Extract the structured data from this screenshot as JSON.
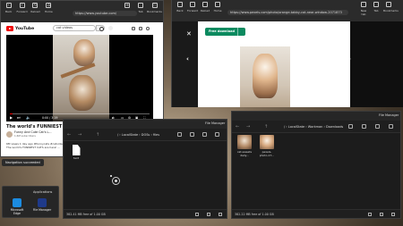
{
  "browser": {
    "tabs_label": "Microsoft Edge",
    "toolbar": [
      "Back",
      "Forward",
      "Reload",
      "Home",
      "New tab",
      "Tab",
      "Bookmarks"
    ],
    "url": "https://www.youtube.com/",
    "youtube": {
      "logo_text": "YouTube",
      "search_value": "cat videos",
      "video_time": "0:00 / 3:19",
      "video_progress": 0.02,
      "title": "The world's FUNNIEST CATS 😹 - ...",
      "channel_name": "Funny And Cute Cat's L...",
      "channel_subs": "1.6M subscribers",
      "description": "6M views  1 day ago  #funnycats #catvideos\nThe world's FUNNIEST CATS are here! ..."
    }
  },
  "toast": "Navigation succeeded",
  "flyout": {
    "title": "Applications",
    "apps": [
      {
        "label_line1": "Microsoft",
        "label_line2": "Edge",
        "color": "#1c8be0"
      },
      {
        "label_line1": "File Manager",
        "label_line2": "",
        "color": "#1f3a8a"
      }
    ]
  },
  "viewer": {
    "tab_label": "Microsoft Edge",
    "toolbar": [
      "Back",
      "Forward",
      "Reload",
      "Home",
      "New tab",
      "Tab",
      "Bookmarks"
    ],
    "url": "https://www.pexels.com/photo/orange-tabby-cat-near-window-2071873",
    "download_label": "Free download"
  },
  "file_manager_1": {
    "title": "File Manager",
    "path": "/ › LocalState › DOSs › files",
    "files": [
      {
        "name": "text"
      }
    ],
    "footer": "382.41 MB free of 1.00 GB"
  },
  "file_manager_2": {
    "title": "File Manager",
    "path": "/ › LocalState › Workman › Downloads",
    "files": [
      {
        "name_line1": "cat-sweets",
        "name_line2": "daily..."
      },
      {
        "name_line1": "pexels-",
        "name_line2": "photo-17..."
      }
    ],
    "footer": "382.22 MB free of 1.00 GB"
  },
  "colors": {
    "youtube_red": "#ff0000",
    "download_green": "#0b8a5f",
    "edge_blue": "#1c8be0"
  }
}
